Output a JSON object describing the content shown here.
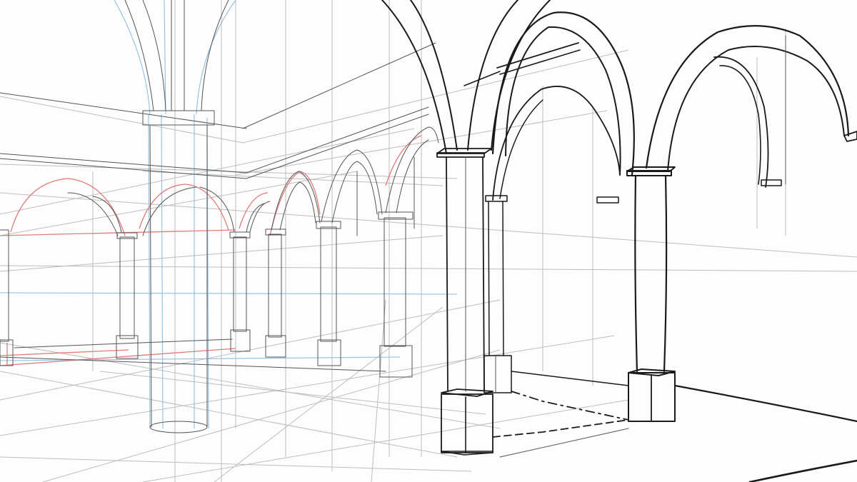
{
  "image": {
    "subject": "arcade-perspective-sketch",
    "colors": {
      "paper": "#fdfdfd",
      "ink": "#1a1a1a",
      "pencil": "#555555",
      "construction": "#bdbdbd",
      "blue_guides": "#8fbfe0",
      "red_guides": "#e27a7a"
    }
  }
}
